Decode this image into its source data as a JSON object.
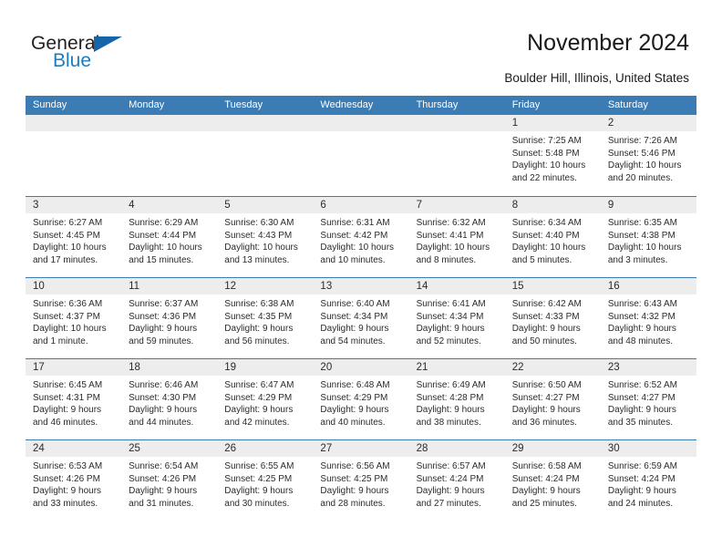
{
  "brand": {
    "name_top": "General",
    "name_bottom": "Blue",
    "color_dark": "#231f20",
    "color_blue": "#1b7dc1",
    "triangle_color": "#1565a8"
  },
  "header": {
    "title": "November 2024",
    "subtitle": "Boulder Hill, Illinois, United States"
  },
  "theme": {
    "header_bg": "#3b7cb5",
    "header_text": "#ffffff",
    "day_band_bg": "#ededed",
    "cell_bg": "#ffffff",
    "text": "#2b2b2b"
  },
  "calendar": {
    "weekdays": [
      "Sunday",
      "Monday",
      "Tuesday",
      "Wednesday",
      "Thursday",
      "Friday",
      "Saturday"
    ],
    "weeks": [
      [
        {
          "day": "",
          "lines": []
        },
        {
          "day": "",
          "lines": []
        },
        {
          "day": "",
          "lines": []
        },
        {
          "day": "",
          "lines": []
        },
        {
          "day": "",
          "lines": []
        },
        {
          "day": "1",
          "lines": [
            "Sunrise: 7:25 AM",
            "Sunset: 5:48 PM",
            "Daylight: 10 hours",
            "and 22 minutes."
          ]
        },
        {
          "day": "2",
          "lines": [
            "Sunrise: 7:26 AM",
            "Sunset: 5:46 PM",
            "Daylight: 10 hours",
            "and 20 minutes."
          ]
        }
      ],
      [
        {
          "day": "3",
          "lines": [
            "Sunrise: 6:27 AM",
            "Sunset: 4:45 PM",
            "Daylight: 10 hours",
            "and 17 minutes."
          ]
        },
        {
          "day": "4",
          "lines": [
            "Sunrise: 6:29 AM",
            "Sunset: 4:44 PM",
            "Daylight: 10 hours",
            "and 15 minutes."
          ]
        },
        {
          "day": "5",
          "lines": [
            "Sunrise: 6:30 AM",
            "Sunset: 4:43 PM",
            "Daylight: 10 hours",
            "and 13 minutes."
          ]
        },
        {
          "day": "6",
          "lines": [
            "Sunrise: 6:31 AM",
            "Sunset: 4:42 PM",
            "Daylight: 10 hours",
            "and 10 minutes."
          ]
        },
        {
          "day": "7",
          "lines": [
            "Sunrise: 6:32 AM",
            "Sunset: 4:41 PM",
            "Daylight: 10 hours",
            "and 8 minutes."
          ]
        },
        {
          "day": "8",
          "lines": [
            "Sunrise: 6:34 AM",
            "Sunset: 4:40 PM",
            "Daylight: 10 hours",
            "and 5 minutes."
          ]
        },
        {
          "day": "9",
          "lines": [
            "Sunrise: 6:35 AM",
            "Sunset: 4:38 PM",
            "Daylight: 10 hours",
            "and 3 minutes."
          ]
        }
      ],
      [
        {
          "day": "10",
          "lines": [
            "Sunrise: 6:36 AM",
            "Sunset: 4:37 PM",
            "Daylight: 10 hours",
            "and 1 minute."
          ]
        },
        {
          "day": "11",
          "lines": [
            "Sunrise: 6:37 AM",
            "Sunset: 4:36 PM",
            "Daylight: 9 hours",
            "and 59 minutes."
          ]
        },
        {
          "day": "12",
          "lines": [
            "Sunrise: 6:38 AM",
            "Sunset: 4:35 PM",
            "Daylight: 9 hours",
            "and 56 minutes."
          ]
        },
        {
          "day": "13",
          "lines": [
            "Sunrise: 6:40 AM",
            "Sunset: 4:34 PM",
            "Daylight: 9 hours",
            "and 54 minutes."
          ]
        },
        {
          "day": "14",
          "lines": [
            "Sunrise: 6:41 AM",
            "Sunset: 4:34 PM",
            "Daylight: 9 hours",
            "and 52 minutes."
          ]
        },
        {
          "day": "15",
          "lines": [
            "Sunrise: 6:42 AM",
            "Sunset: 4:33 PM",
            "Daylight: 9 hours",
            "and 50 minutes."
          ]
        },
        {
          "day": "16",
          "lines": [
            "Sunrise: 6:43 AM",
            "Sunset: 4:32 PM",
            "Daylight: 9 hours",
            "and 48 minutes."
          ]
        }
      ],
      [
        {
          "day": "17",
          "lines": [
            "Sunrise: 6:45 AM",
            "Sunset: 4:31 PM",
            "Daylight: 9 hours",
            "and 46 minutes."
          ]
        },
        {
          "day": "18",
          "lines": [
            "Sunrise: 6:46 AM",
            "Sunset: 4:30 PM",
            "Daylight: 9 hours",
            "and 44 minutes."
          ]
        },
        {
          "day": "19",
          "lines": [
            "Sunrise: 6:47 AM",
            "Sunset: 4:29 PM",
            "Daylight: 9 hours",
            "and 42 minutes."
          ]
        },
        {
          "day": "20",
          "lines": [
            "Sunrise: 6:48 AM",
            "Sunset: 4:29 PM",
            "Daylight: 9 hours",
            "and 40 minutes."
          ]
        },
        {
          "day": "21",
          "lines": [
            "Sunrise: 6:49 AM",
            "Sunset: 4:28 PM",
            "Daylight: 9 hours",
            "and 38 minutes."
          ]
        },
        {
          "day": "22",
          "lines": [
            "Sunrise: 6:50 AM",
            "Sunset: 4:27 PM",
            "Daylight: 9 hours",
            "and 36 minutes."
          ]
        },
        {
          "day": "23",
          "lines": [
            "Sunrise: 6:52 AM",
            "Sunset: 4:27 PM",
            "Daylight: 9 hours",
            "and 35 minutes."
          ]
        }
      ],
      [
        {
          "day": "24",
          "lines": [
            "Sunrise: 6:53 AM",
            "Sunset: 4:26 PM",
            "Daylight: 9 hours",
            "and 33 minutes."
          ]
        },
        {
          "day": "25",
          "lines": [
            "Sunrise: 6:54 AM",
            "Sunset: 4:26 PM",
            "Daylight: 9 hours",
            "and 31 minutes."
          ]
        },
        {
          "day": "26",
          "lines": [
            "Sunrise: 6:55 AM",
            "Sunset: 4:25 PM",
            "Daylight: 9 hours",
            "and 30 minutes."
          ]
        },
        {
          "day": "27",
          "lines": [
            "Sunrise: 6:56 AM",
            "Sunset: 4:25 PM",
            "Daylight: 9 hours",
            "and 28 minutes."
          ]
        },
        {
          "day": "28",
          "lines": [
            "Sunrise: 6:57 AM",
            "Sunset: 4:24 PM",
            "Daylight: 9 hours",
            "and 27 minutes."
          ]
        },
        {
          "day": "29",
          "lines": [
            "Sunrise: 6:58 AM",
            "Sunset: 4:24 PM",
            "Daylight: 9 hours",
            "and 25 minutes."
          ]
        },
        {
          "day": "30",
          "lines": [
            "Sunrise: 6:59 AM",
            "Sunset: 4:24 PM",
            "Daylight: 9 hours",
            "and 24 minutes."
          ]
        }
      ]
    ]
  }
}
